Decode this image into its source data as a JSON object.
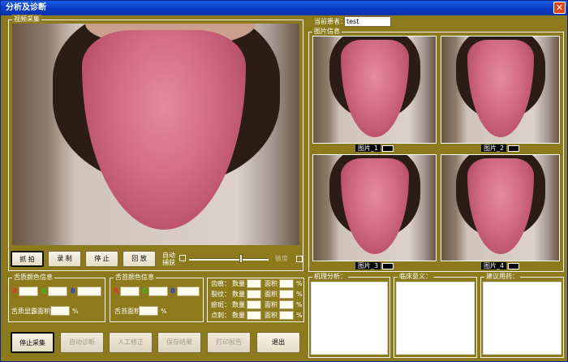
{
  "window": {
    "title": "分析及诊断",
    "close_glyph": "✕"
  },
  "video_group": {
    "label": "视频采集"
  },
  "controls": {
    "capture": "抓 拍",
    "record": "录 制",
    "stop": "停 止",
    "playback": "回 放",
    "auto_capture_line1": "自动",
    "auto_capture_line2": "捕获",
    "sensitivity": "敏度"
  },
  "patient": {
    "label": "当前患者：",
    "value": "test"
  },
  "photo_group": {
    "label": "图片信息"
  },
  "photos": [
    {
      "label": "图片_1"
    },
    {
      "label": "图片_2"
    },
    {
      "label": "图片_3"
    },
    {
      "label": "图片_4"
    }
  ],
  "tongue_color": {
    "label": "舌质颜色信息",
    "r": "R",
    "g": "G",
    "b": "B",
    "area_label": "舌质显露面积",
    "unit": "%"
  },
  "coating_color": {
    "label": "舌苔颜色信息",
    "r": "R",
    "g": "G",
    "b": "B",
    "area_label": "舌苔面积",
    "unit": "%"
  },
  "features": [
    {
      "name": "齿痕：",
      "count": "数量",
      "area": "面积",
      "unit": "%"
    },
    {
      "name": "裂纹：",
      "count": "数量",
      "area": "面积",
      "unit": "%"
    },
    {
      "name": "瘀斑：",
      "count": "数量",
      "area": "面积",
      "unit": "%"
    },
    {
      "name": "点刺：",
      "count": "数量",
      "area": "面积",
      "unit": "%"
    }
  ],
  "analysis": {
    "mechanism": "机理分析：",
    "clinical": "临床意义：",
    "medication": "建议用药："
  },
  "bottom_buttons": {
    "stop_capture": "停止采集",
    "auto_diagnose": "自动诊断",
    "manual_correct": "人工修正",
    "save_result": "保存结果",
    "print_report": "打印报告",
    "exit": "退出"
  },
  "colors": {
    "background": "#8d7a1c",
    "titlebar": "#0a3cc8",
    "accent_red": "#e03030",
    "accent_green": "#26c426",
    "accent_blue": "#2b41c8"
  }
}
